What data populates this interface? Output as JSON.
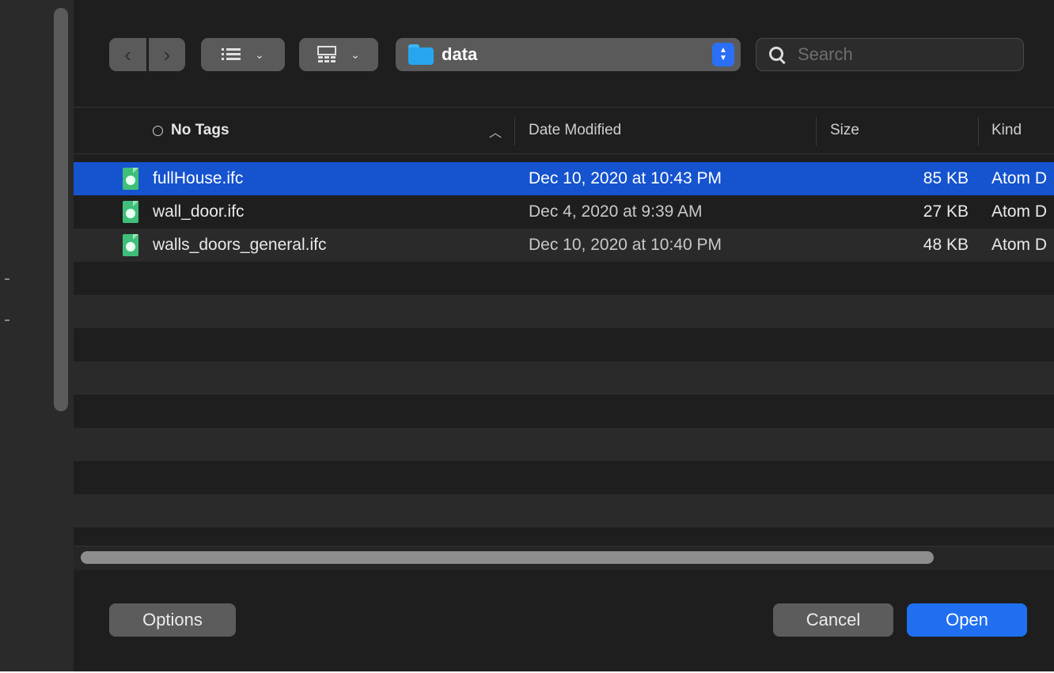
{
  "toolbar": {
    "back_glyph": "‹",
    "forward_glyph": "›",
    "list_icon": "list-view-icon",
    "grid_icon": "icon-grid-icon",
    "path_label": "data",
    "search_placeholder": "Search"
  },
  "columns": {
    "name": "No Tags",
    "date": "Date Modified",
    "size": "Size",
    "kind": "Kind"
  },
  "files": [
    {
      "name": "fullHouse.ifc",
      "date": "Dec 10, 2020 at 10:43 PM",
      "size": "85 KB",
      "kind": "Atom D",
      "selected": true
    },
    {
      "name": "wall_door.ifc",
      "date": "Dec 4, 2020 at 9:39 AM",
      "size": "27 KB",
      "kind": "Atom D",
      "selected": false
    },
    {
      "name": "walls_doors_general.ifc",
      "date": "Dec 10, 2020 at 10:40 PM",
      "size": "48 KB",
      "kind": "Atom D",
      "selected": false
    }
  ],
  "footer": {
    "options_label": "Options",
    "cancel_label": "Cancel",
    "open_label": "Open"
  },
  "colors": {
    "selection": "#1553cf",
    "primary_button": "#1f6ff0",
    "folder": "#27a6ee",
    "file_icon": "#3fbf7a"
  }
}
